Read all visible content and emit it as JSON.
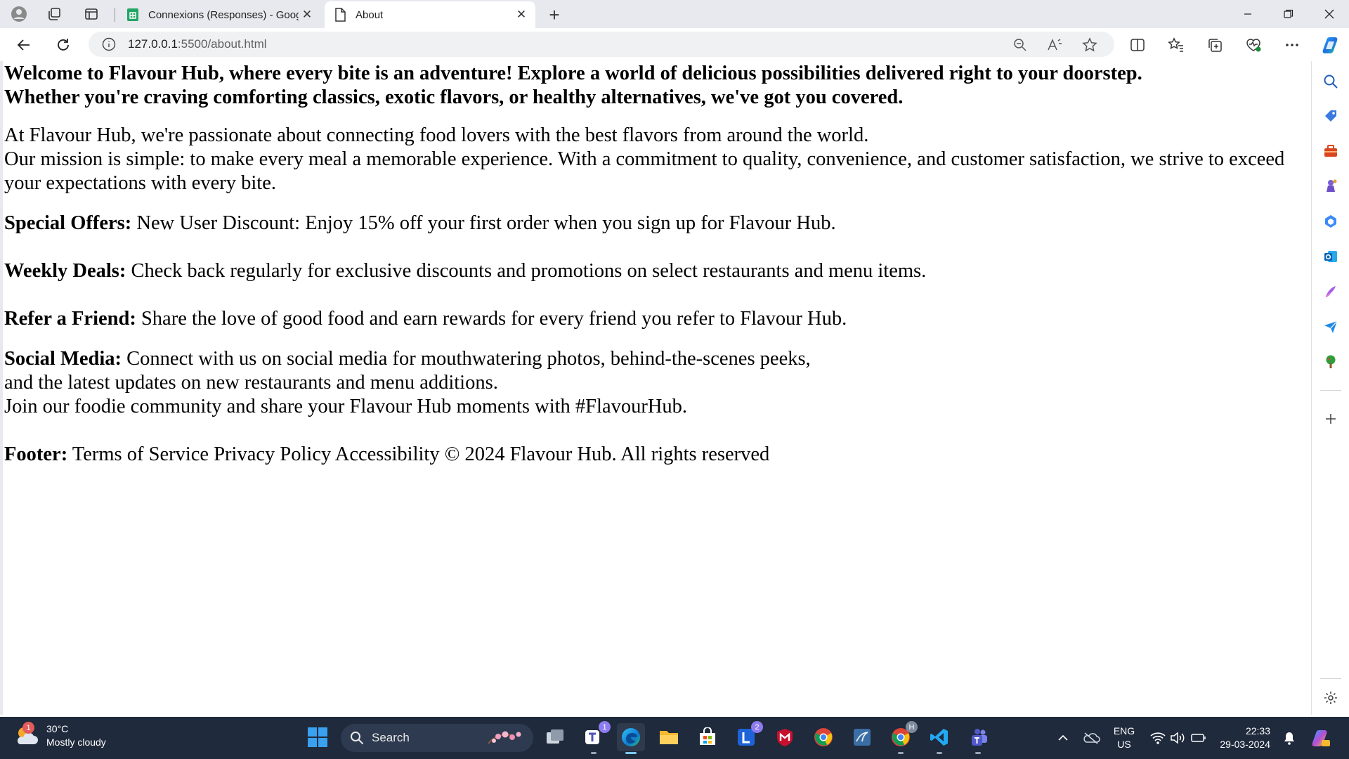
{
  "browser": {
    "tabs": [
      {
        "title": "Connexions (Responses) - Googl",
        "active": false
      },
      {
        "title": "About",
        "active": true
      }
    ],
    "address": {
      "host": "127.0.0.1",
      "path": ":5500/about.html"
    }
  },
  "page": {
    "welcome_line1": "Welcome to Flavour Hub, where every bite is an adventure! Explore a world of delicious possibilities delivered right to your doorstep.",
    "welcome_line2": "Whether you're craving comforting classics, exotic flavors, or healthy alternatives, we've got you covered.",
    "about_line1": "At Flavour Hub, we're passionate about connecting food lovers with the best flavors from around the world.",
    "about_line2": "Our mission is simple: to make every meal a memorable experience. With a commitment to quality, convenience, and customer satisfaction, we strive to exceed your expectations with every bite.",
    "special_offers_label": "Special Offers:",
    "special_offers_text": " New User Discount: Enjoy 15% off your first order when you sign up for Flavour Hub.",
    "weekly_deals_label": "Weekly Deals:",
    "weekly_deals_text": " Check back regularly for exclusive discounts and promotions on select restaurants and menu items.",
    "refer_label": "Refer a Friend:",
    "refer_text": " Share the love of good food and earn rewards for every friend you refer to Flavour Hub.",
    "social_label": "Social Media:",
    "social_text1": " Connect with us on social media for mouthwatering photos, behind-the-scenes peeks,",
    "social_text2": "and the latest updates on new restaurants and menu additions.",
    "social_text3": "Join our foodie community and share your Flavour Hub moments with #FlavourHub.",
    "footer_label": "Footer:",
    "footer_text": " Terms of Service Privacy Policy Accessibility © 2024 Flavour Hub. All rights reserved"
  },
  "taskbar": {
    "weather_temp": "30°C",
    "weather_desc": "Mostly cloudy",
    "weather_badge": "1",
    "search_label": "Search",
    "teams_badge": "1",
    "l_app_badge": "2",
    "chrome_profile_badge": "H",
    "lang_line1": "ENG",
    "lang_line2": "US",
    "time": "22:33",
    "date": "29-03-2024"
  },
  "colors": {
    "tabstrip": "#e7e9ee",
    "taskbar": "#1f2a3c",
    "edge_accent": "#0c7bd6"
  }
}
